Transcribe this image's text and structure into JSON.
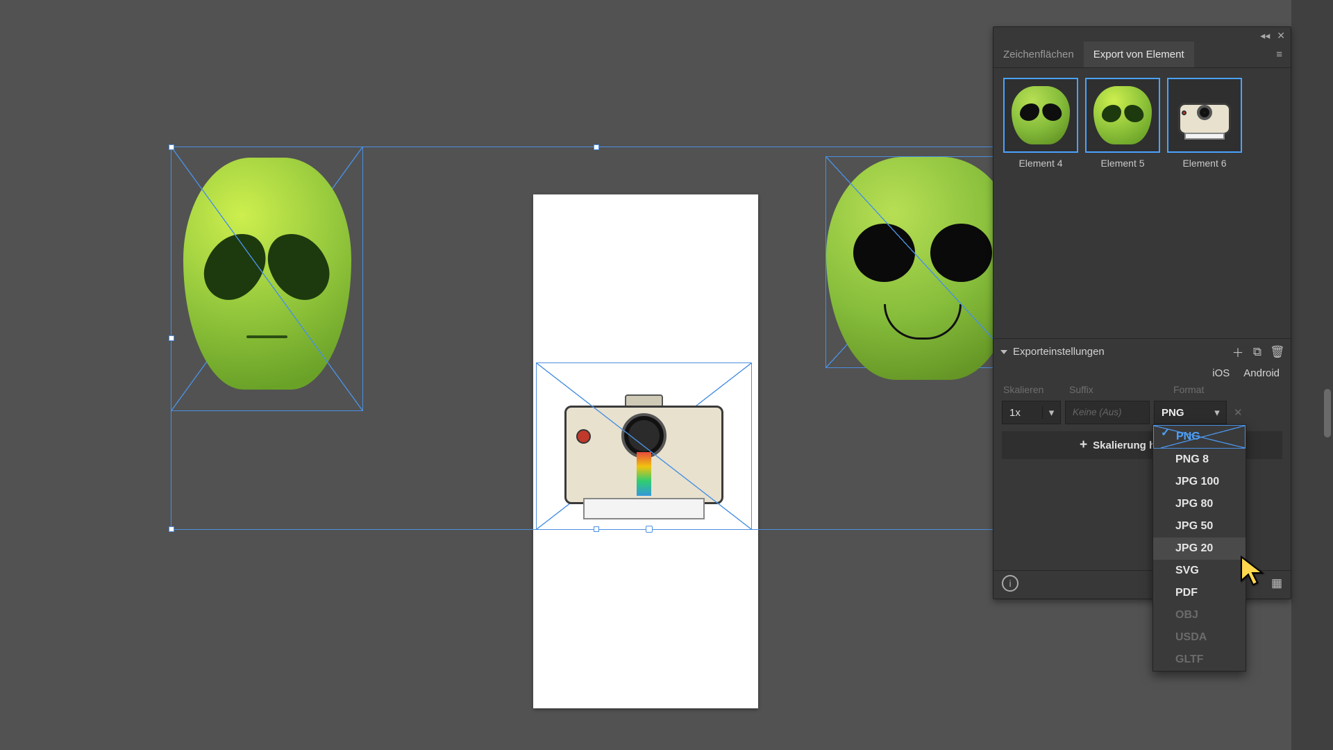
{
  "tabs": {
    "artboards": "Zeichenflächen",
    "export": "Export von Element"
  },
  "elements": [
    {
      "label": "Element 4"
    },
    {
      "label": "Element 5"
    },
    {
      "label": "Element 6"
    }
  ],
  "export": {
    "section_title": "Exporteinstellungen",
    "platforms": {
      "ios": "iOS",
      "android": "Android"
    },
    "columns": {
      "scale": "Skalieren",
      "suffix": "Suffix",
      "format": "Format"
    },
    "scale_value": "1x",
    "suffix_placeholder": "Keine (Aus)",
    "format_value": "PNG",
    "add_scale": "Skalierung hinzufügen"
  },
  "format_options": [
    {
      "label": "PNG",
      "selected": true
    },
    {
      "label": "PNG 8"
    },
    {
      "label": "JPG 100"
    },
    {
      "label": "JPG 80"
    },
    {
      "label": "JPG 50"
    },
    {
      "label": "JPG 20",
      "highlight": true
    },
    {
      "label": "SVG"
    },
    {
      "label": "PDF"
    },
    {
      "label": "OBJ",
      "disabled": true
    },
    {
      "label": "USDA",
      "disabled": true
    },
    {
      "label": "GLTF",
      "disabled": true
    }
  ]
}
